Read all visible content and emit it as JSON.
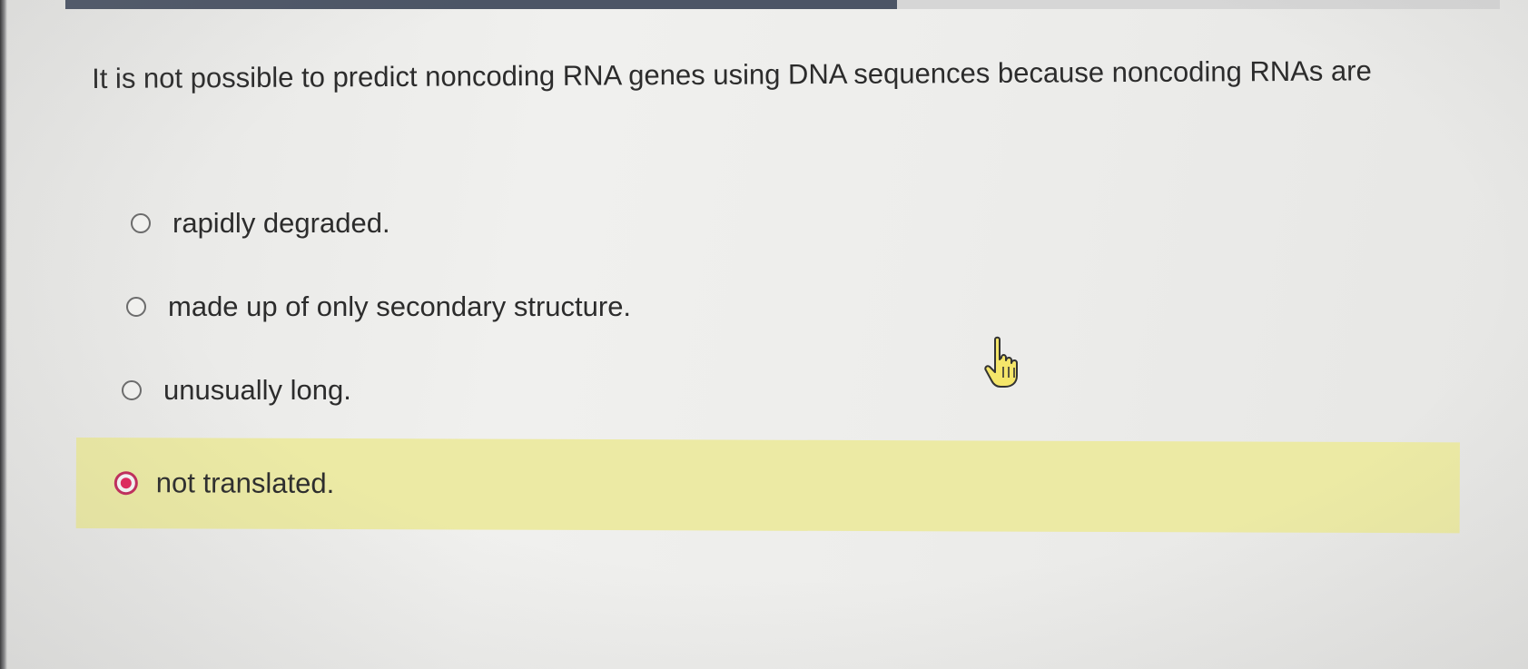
{
  "progress": {
    "fraction": 0.58
  },
  "question": {
    "text": "It is not possible to predict noncoding RNA genes using DNA sequences because noncoding RNAs are"
  },
  "options": [
    {
      "label": "rapidly degraded.",
      "selected": false
    },
    {
      "label": "made up of only secondary structure.",
      "selected": false
    },
    {
      "label": "unusually long.",
      "selected": false
    },
    {
      "label": "not translated.",
      "selected": true
    }
  ],
  "colors": {
    "progress_fill": "#4c5566",
    "selected_highlight": "#eceaa4",
    "radio_selected": "#e2245c"
  },
  "cursor": {
    "icon": "hand-pointer-icon"
  }
}
